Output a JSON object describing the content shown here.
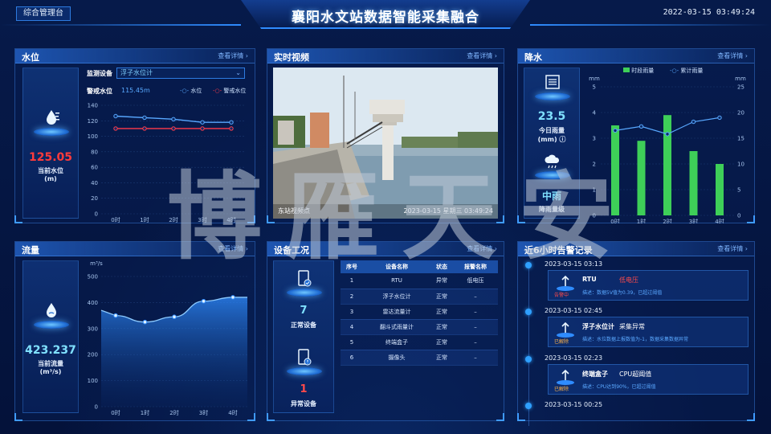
{
  "header": {
    "left_button": "综合管理台",
    "title": "襄阳水文站数据智能采集融合",
    "datetime": "2022-03-15  03:49:24"
  },
  "common": {
    "more": "查看详情 ›"
  },
  "water_level": {
    "title": "水位",
    "icon": "water-level-icon",
    "value": "125.05",
    "value_color": "#ff3b3b",
    "label": "当前水位",
    "unit": "(m)",
    "device_label": "监测设备",
    "device_select": "浮子水位计",
    "warn_label": "警戒水位",
    "warn_value": "115.45m",
    "legend": [
      "水位",
      "警戒水位"
    ],
    "chart_data": {
      "type": "line",
      "categories": [
        "0时",
        "1时",
        "2时",
        "3时",
        "4时"
      ],
      "series": [
        {
          "name": "水位",
          "values": [
            126,
            124,
            122,
            118,
            118
          ],
          "color": "#58a8ff"
        },
        {
          "name": "警戒水位",
          "values": [
            110,
            110,
            110,
            110,
            110
          ],
          "color": "#ff3b4b"
        }
      ],
      "ylim": [
        0,
        140
      ],
      "yticks": [
        0,
        20,
        40,
        60,
        80,
        100,
        120,
        140
      ]
    }
  },
  "video": {
    "title": "实时视频",
    "caption_left": "东站视频点",
    "caption_right": "2023-03-15 星期三 03:49:24"
  },
  "rain": {
    "title": "降水",
    "value": "23.5",
    "today_label": "今日雨量",
    "today_unit": "(mm) ⓘ",
    "level": "中雨",
    "level_label": "降雨量级",
    "chart_data": {
      "type": "bar",
      "categories": [
        "0时",
        "1时",
        "2时",
        "3时",
        "4时"
      ],
      "series": [
        {
          "name": "时段雨量",
          "values": [
            3.5,
            2.9,
            3.9,
            2.5,
            2.0
          ],
          "color": "#3ecf58"
        },
        {
          "name": "累计雨量",
          "values": [
            16.5,
            17.3,
            15.8,
            18.2,
            19.0
          ],
          "color": "#58a8ff"
        }
      ],
      "ylabel_left": "mm",
      "ylabel_right": "mm",
      "ylim_left": [
        0,
        5
      ],
      "ylim_right": [
        0,
        25
      ],
      "yticks_left": [
        0,
        1,
        2,
        3,
        4,
        5
      ],
      "yticks_right": [
        0,
        5,
        10,
        15,
        20,
        25
      ]
    }
  },
  "flow": {
    "title": "流量",
    "value": "423.237",
    "label": "当前流量",
    "unit": "(m³/s)",
    "chart_data": {
      "type": "area",
      "categories": [
        "0时",
        "1时",
        "2时",
        "3时",
        "4时"
      ],
      "values": [
        350,
        325,
        345,
        405,
        420
      ],
      "ylabel": "m³/s",
      "ylim": [
        0,
        500
      ],
      "yticks": [
        0,
        100,
        200,
        300,
        400,
        500
      ]
    }
  },
  "devices": {
    "title": "设备工况",
    "normal_count": "7",
    "normal_label": "正常设备",
    "abnormal_count": "1",
    "abnormal_label": "异常设备",
    "columns": [
      "序号",
      "设备名称",
      "状态",
      "报警名称"
    ],
    "rows": [
      {
        "no": "1",
        "name": "RTU",
        "status": "异常",
        "alarm": "低电压",
        "bad": true
      },
      {
        "no": "2",
        "name": "浮子水位计",
        "status": "正常",
        "alarm": "–",
        "bad": false
      },
      {
        "no": "3",
        "name": "雷达流量计",
        "status": "正常",
        "alarm": "–",
        "bad": false
      },
      {
        "no": "4",
        "name": "翻斗式雨量计",
        "status": "正常",
        "alarm": "–",
        "bad": false
      },
      {
        "no": "5",
        "name": "终端盒子",
        "status": "正常",
        "alarm": "–",
        "bad": false
      },
      {
        "no": "6",
        "name": "摄像头",
        "status": "正常",
        "alarm": "–",
        "bad": false
      }
    ]
  },
  "alarms": {
    "title": "近6小时告警记录",
    "items": [
      {
        "time": "2023-03-15  03:13",
        "device": "RTU",
        "type": "低电压",
        "desc": "描述：数据5V值为0.39，已超过阈值",
        "badge": "告警中",
        "badge_color": "#ff4a4a",
        "type_color": "#ff4a4a"
      },
      {
        "time": "2023-03-15  02:45",
        "device": "浮子水位计",
        "type": "采集异常",
        "desc": "描述：水位数据上报数值为-1，数据采集数据异常",
        "badge": "已解除",
        "badge_color": "#ffb347",
        "type_color": "#ffffff"
      },
      {
        "time": "2023-03-15  02:23",
        "device": "终端盒子",
        "type": "CPU超阈值",
        "desc": "描述：CPU达到90%，已超过阈值",
        "badge": "已解除",
        "badge_color": "#ffb347",
        "type_color": "#ffffff"
      },
      {
        "time": "2023-03-15  00:25"
      }
    ]
  },
  "watermark": "博雁天安"
}
